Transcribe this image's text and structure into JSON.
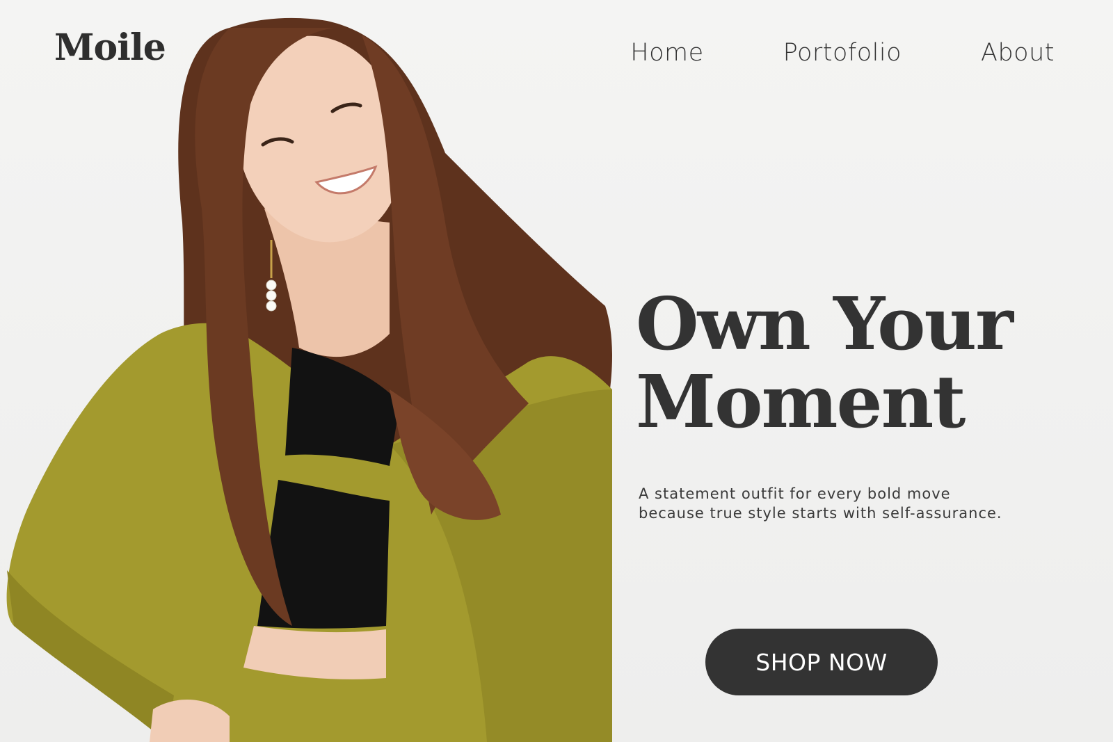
{
  "brand": {
    "logo_text": "Moile"
  },
  "nav": {
    "items": [
      {
        "label": "Home"
      },
      {
        "label": "Portofolio"
      },
      {
        "label": "About"
      }
    ]
  },
  "hero": {
    "headline_line1": "Own Your",
    "headline_line2": "Moment",
    "subtext_line1": "A statement outfit for every bold move",
    "subtext_line2": "because true style starts with self-assurance.",
    "cta_label": "SHOP NOW",
    "photo_icon": "model-photo",
    "colors": {
      "background": "#f0f0ef",
      "text": "#333333",
      "button": "#333333",
      "button_text": "#ffffff",
      "blazer": "#a39a2e",
      "hair": "#6b3a22"
    }
  }
}
